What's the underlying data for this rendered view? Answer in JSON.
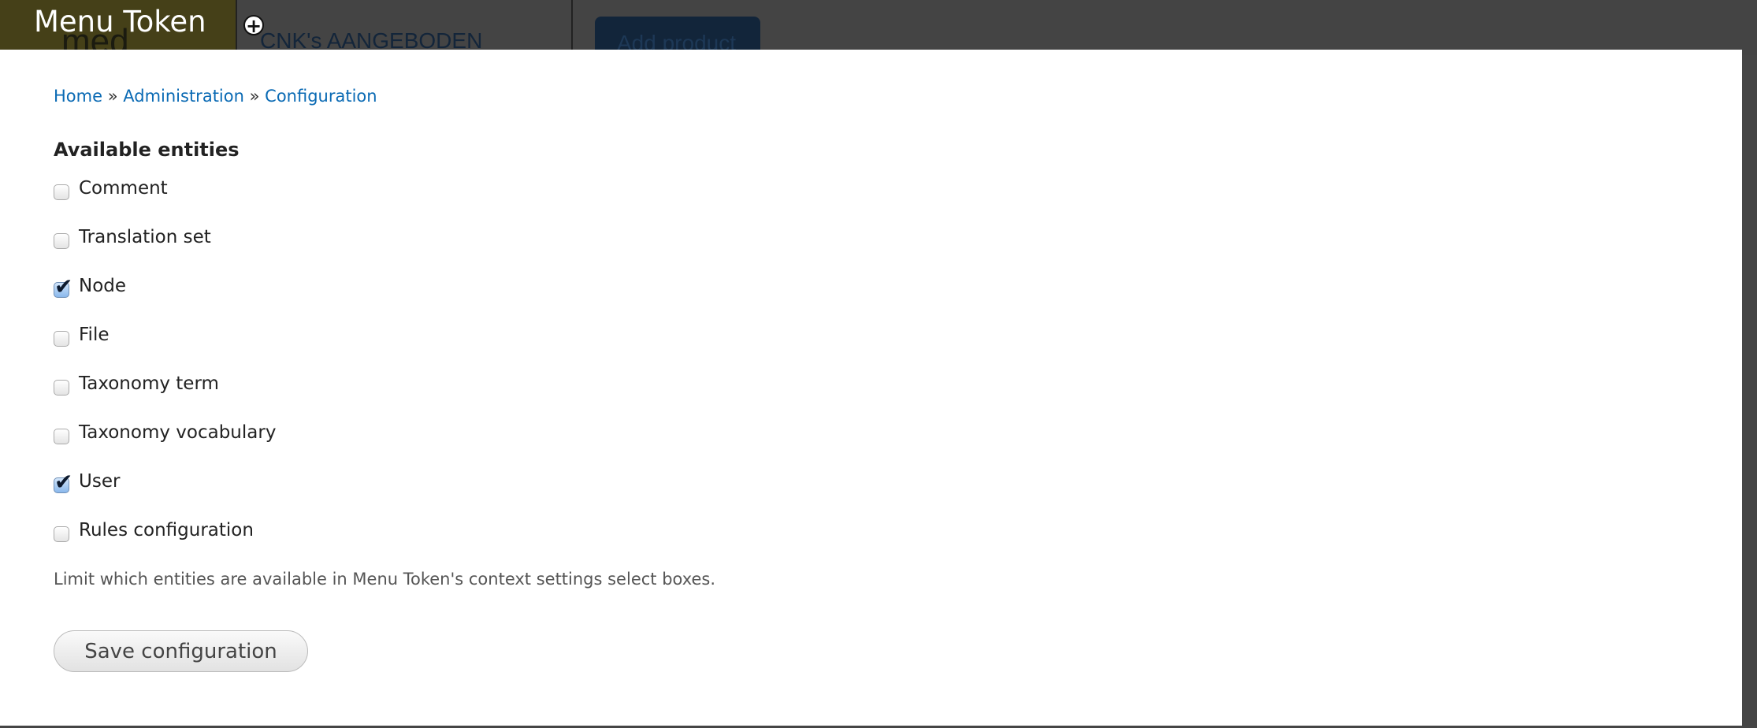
{
  "background": {
    "logo_text": "med",
    "nav_item": "CNK's AANGEBODEN",
    "add_product_label": "Add product"
  },
  "overlay": {
    "title": "Menu Token",
    "add_icon": "plus-circle-icon"
  },
  "breadcrumb": [
    {
      "label": "Home"
    },
    {
      "label": "Administration"
    },
    {
      "label": "Configuration"
    }
  ],
  "breadcrumb_separator": "»",
  "form": {
    "legend": "Available entities",
    "options": [
      {
        "label": "Comment",
        "checked": false
      },
      {
        "label": "Translation set",
        "checked": false
      },
      {
        "label": "Node",
        "checked": true
      },
      {
        "label": "File",
        "checked": false
      },
      {
        "label": "Taxonomy term",
        "checked": false
      },
      {
        "label": "Taxonomy vocabulary",
        "checked": false
      },
      {
        "label": "User",
        "checked": true
      },
      {
        "label": "Rules configuration",
        "checked": false
      }
    ],
    "description": "Limit which entities are available in Menu Token's context settings select boxes.",
    "save_label": "Save configuration"
  },
  "colors": {
    "link": "#0a6ab4",
    "header_bg": "#444444"
  }
}
